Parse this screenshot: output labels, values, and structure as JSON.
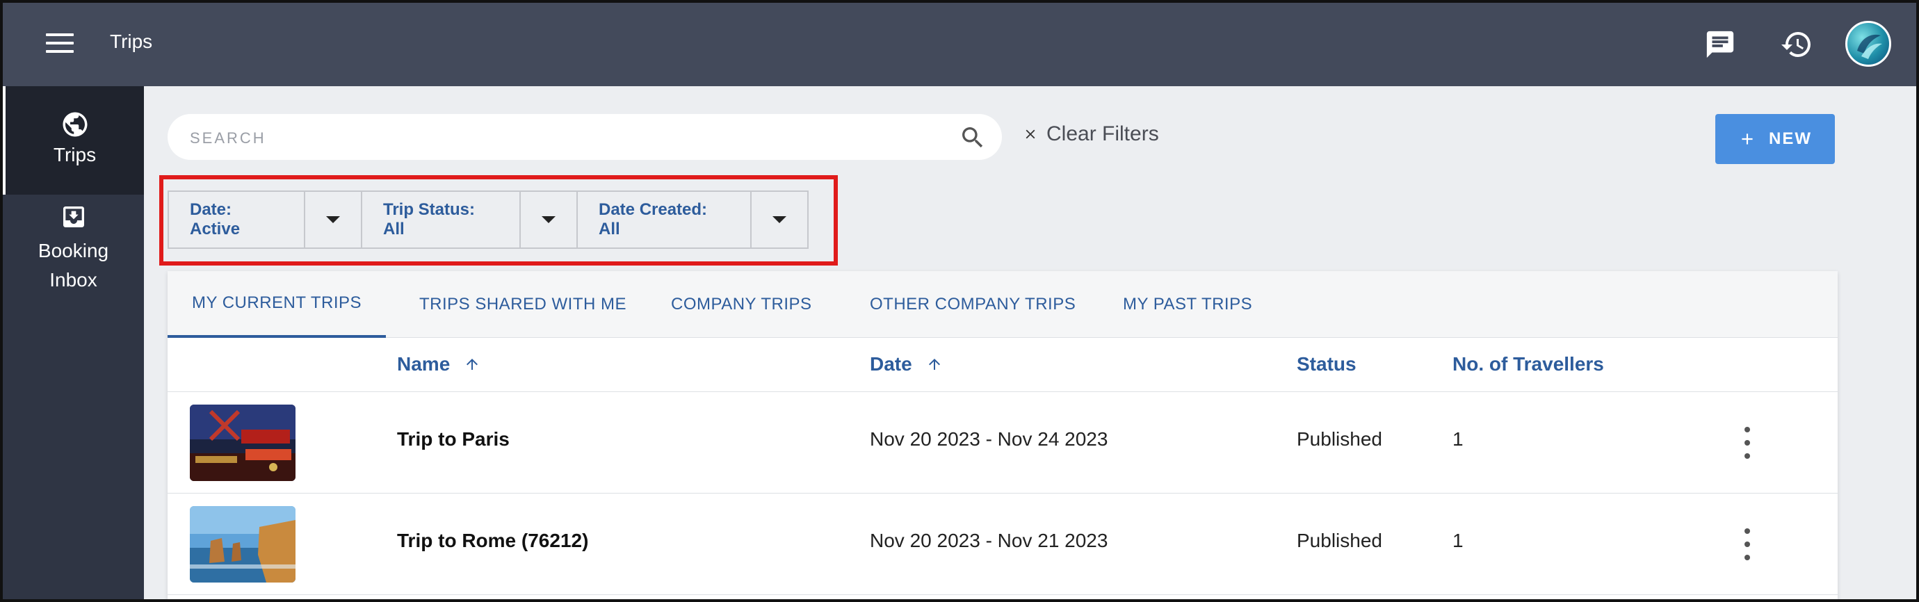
{
  "header": {
    "title": "Trips",
    "icons": [
      "menu-icon",
      "chat-icon",
      "history-icon",
      "avatar"
    ]
  },
  "sidebar": {
    "items": [
      {
        "label": "Trips",
        "icon": "globe-icon",
        "active": true
      },
      {
        "label": "Booking Inbox",
        "icon": "inbox-download-icon",
        "active": false
      }
    ]
  },
  "search": {
    "placeholder": "SEARCH"
  },
  "clear_filters": {
    "label": "Clear Filters"
  },
  "new_button": {
    "label": "NEW"
  },
  "filters": [
    {
      "label": "Date: Active"
    },
    {
      "label": "Trip Status: All"
    },
    {
      "label": "Date Created: All"
    }
  ],
  "tabs": [
    {
      "label": "MY CURRENT TRIPS",
      "active": true
    },
    {
      "label": "TRIPS SHARED WITH ME",
      "active": false
    },
    {
      "label": "COMPANY TRIPS",
      "active": false
    },
    {
      "label": "OTHER COMPANY TRIPS",
      "active": false
    },
    {
      "label": "MY PAST TRIPS",
      "active": false
    }
  ],
  "table": {
    "columns": [
      "Name",
      "Date",
      "Status",
      "No. of Travellers"
    ],
    "rows": [
      {
        "name": "Trip to Paris",
        "date": "Nov 20 2023 - Nov 24 2023",
        "status": "Published",
        "travellers": "1",
        "thumbnail": "paris-moulin-rouge-image"
      },
      {
        "name": "Trip to Rome (76212)",
        "date": "Nov 20 2023 - Nov 21 2023",
        "status": "Published",
        "travellers": "1",
        "thumbnail": "coastal-cliffs-image"
      }
    ]
  },
  "colors": {
    "topbar": "#434a5b",
    "sidebar": "#2f3544",
    "accent": "#2d5c9c",
    "new_button": "#4a8fe0",
    "highlight": "#e01b1b"
  }
}
